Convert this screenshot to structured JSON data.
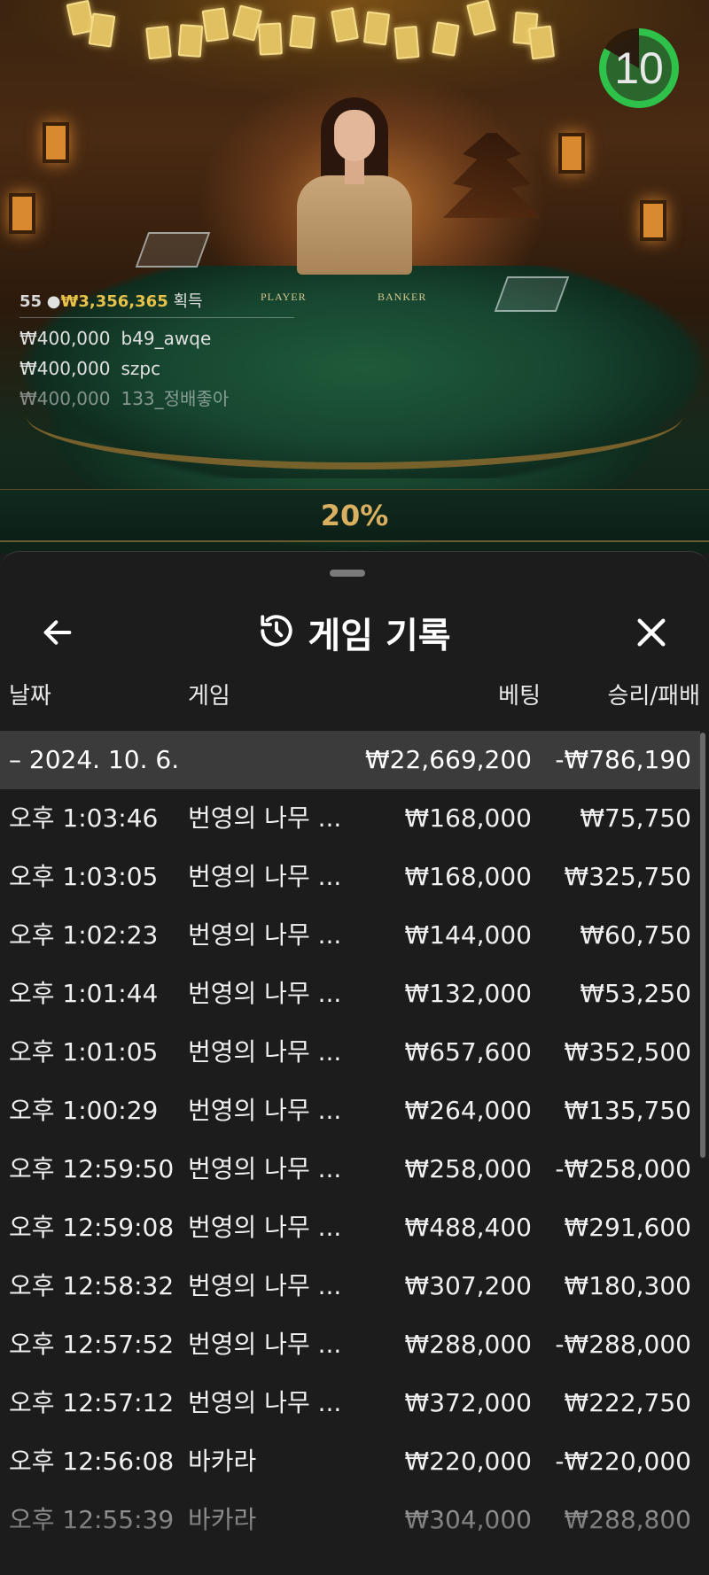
{
  "video": {
    "timer": "10",
    "table_labels": {
      "player": "PLAYER",
      "banker": "BANKER"
    },
    "winners": {
      "count": "55",
      "total": "₩3,356,365",
      "suffix": "획득",
      "rows": [
        {
          "amount": "₩400,000",
          "name": "b49_awqe"
        },
        {
          "amount": "₩400,000",
          "name": "szpc"
        },
        {
          "amount": "₩400,000",
          "name": "133_정배좋아"
        }
      ]
    },
    "progress_label": "20%",
    "progress": 0.2
  },
  "sheet": {
    "title": "게임 기록",
    "icons": {
      "back": "arrow-left-icon",
      "history": "history-icon",
      "close": "close-icon"
    },
    "columns": {
      "date": "날짜",
      "game": "게임",
      "bet": "베팅",
      "result": "승리/패배"
    },
    "group": {
      "date": "– 2024. 10. 6.",
      "bet": "₩22,669,200",
      "result": "-₩786,190"
    },
    "rows": [
      {
        "time": "오후 1:03:46",
        "game": "번영의 나무 ...",
        "bet": "₩168,000",
        "result": "₩75,750"
      },
      {
        "time": "오후 1:03:05",
        "game": "번영의 나무 ...",
        "bet": "₩168,000",
        "result": "₩325,750"
      },
      {
        "time": "오후 1:02:23",
        "game": "번영의 나무 ...",
        "bet": "₩144,000",
        "result": "₩60,750"
      },
      {
        "time": "오후 1:01:44",
        "game": "번영의 나무 ...",
        "bet": "₩132,000",
        "result": "₩53,250"
      },
      {
        "time": "오후 1:01:05",
        "game": "번영의 나무 ...",
        "bet": "₩657,600",
        "result": "₩352,500"
      },
      {
        "time": "오후 1:00:29",
        "game": "번영의 나무 ...",
        "bet": "₩264,000",
        "result": "₩135,750"
      },
      {
        "time": "오후 12:59:50",
        "game": "번영의 나무 ...",
        "bet": "₩258,000",
        "result": "-₩258,000"
      },
      {
        "time": "오후 12:59:08",
        "game": "번영의 나무 ...",
        "bet": "₩488,400",
        "result": "₩291,600"
      },
      {
        "time": "오후 12:58:32",
        "game": "번영의 나무 ...",
        "bet": "₩307,200",
        "result": "₩180,300"
      },
      {
        "time": "오후 12:57:52",
        "game": "번영의 나무 ...",
        "bet": "₩288,000",
        "result": "-₩288,000"
      },
      {
        "time": "오후 12:57:12",
        "game": "번영의 나무 ...",
        "bet": "₩372,000",
        "result": "₩222,750"
      },
      {
        "time": "오후 12:56:08",
        "game": "바카라",
        "bet": "₩220,000",
        "result": "-₩220,000"
      },
      {
        "time": "오후 12:55:39",
        "game": "바카라",
        "bet": "₩304,000",
        "result": "₩288,800"
      }
    ]
  }
}
